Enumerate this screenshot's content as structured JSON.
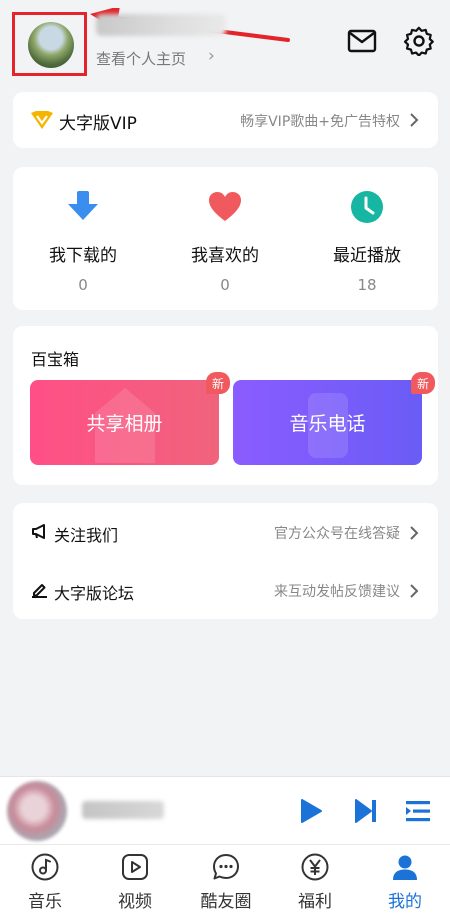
{
  "header": {
    "profile_link": "查看个人主页",
    "colors": {
      "highlight": "#e3242b"
    }
  },
  "vip": {
    "title": "大字版VIP",
    "desc": "畅享VIP歌曲+免广告特权",
    "badge_color": "#f5b400"
  },
  "stats": [
    {
      "label": "我下载的",
      "count": "0",
      "icon": "download-arrow-icon",
      "color": "#3a8ef0"
    },
    {
      "label": "我喜欢的",
      "count": "0",
      "icon": "heart-icon",
      "color": "#f05a5e"
    },
    {
      "label": "最近播放",
      "count": "18",
      "icon": "clock-icon",
      "color": "#17b6a3"
    }
  ],
  "toolbox": {
    "title": "百宝箱",
    "tiles": [
      {
        "label": "共享相册",
        "badge": "新",
        "color": "#ff4f86"
      },
      {
        "label": "音乐电话",
        "badge": "新",
        "color": "#7b5cfa"
      }
    ]
  },
  "links": [
    {
      "title": "关注我们",
      "desc": "官方公众号在线答疑",
      "icon": "megaphone-icon"
    },
    {
      "title": "大字版论坛",
      "desc": "来互动发帖反馈建议",
      "icon": "pencil-icon"
    }
  ],
  "player": {
    "accent": "#1b73d8"
  },
  "nav": [
    {
      "label": "音乐",
      "icon": "music-note-icon"
    },
    {
      "label": "视频",
      "icon": "video-play-icon"
    },
    {
      "label": "酷友圈",
      "icon": "chat-bubble-icon"
    },
    {
      "label": "福利",
      "icon": "yen-coin-icon"
    },
    {
      "label": "我的",
      "icon": "user-icon"
    }
  ]
}
